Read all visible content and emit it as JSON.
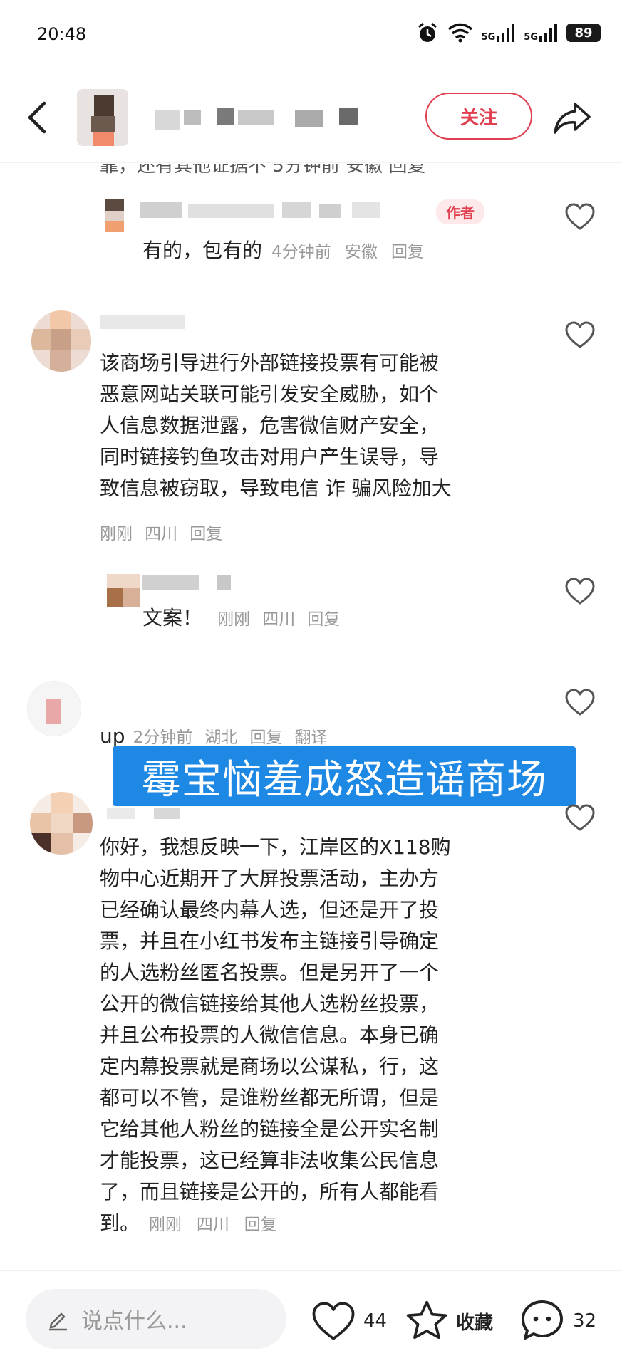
{
  "status_bar": {
    "time": "20:48",
    "network_1": "5G",
    "network_2": "5G",
    "battery": "89"
  },
  "header": {
    "follow_label": "关注"
  },
  "cut_line": "靠，还有其他证据不  5分钟前  安徽  回复",
  "comments": [
    {
      "author_tag": "作者",
      "text": "有的，包有的",
      "time": "4分钟前",
      "location": "安徽",
      "reply": "回复"
    },
    {
      "text_lines": [
        "该商场引导进行外部链接投票有可能被",
        "恶意网站关联可能引发安全威胁，如个",
        "人信息数据泄露，危害微信财产安全，",
        "同时链接钓鱼攻击对用户产生误导，导",
        "致信息被窃取，导致电信 诈 骗风险加大"
      ],
      "time": "刚刚",
      "location": "四川",
      "reply": "回复"
    },
    {
      "text": "文案！",
      "time": "刚刚",
      "location": "四川",
      "reply": "回复"
    },
    {
      "text": "up",
      "time": "2分钟前",
      "location": "湖北",
      "reply": "回复",
      "translate": "翻译"
    },
    {
      "text_lines": [
        "你好，我想反映一下，江岸区的X118购",
        "物中心近期开了大屏投票活动，主办方",
        "已经确认最终内幕人选，但还是开了投",
        "票，并且在小红书发布主链接引导确定",
        "的人选粉丝匿名投票。但是另开了一个",
        "公开的微信链接给其他人选粉丝投票，",
        "并且公布投票的人微信信息。本身已确",
        "定内幕投票就是商场以公谋私，行，这",
        "都可以不管，是谁粉丝都无所谓，但是",
        "它给其他人粉丝的链接全是公开实名制",
        "才能投票，这已经算非法收集公民信息",
        "了，而且链接是公开的，所有人都能看"
      ],
      "last_line": "到。",
      "time": "刚刚",
      "location": "四川",
      "reply": "回复"
    }
  ],
  "overlay_banner": "霉宝恼羞成怒造谣商场",
  "bottom_bar": {
    "input_placeholder": "说点什么...",
    "like_count": "44",
    "collect_label": "收藏",
    "comment_count": "32"
  },
  "colors": {
    "accent": "#e0404f",
    "banner": "#1e88e5",
    "link": "#3a6fd0"
  }
}
